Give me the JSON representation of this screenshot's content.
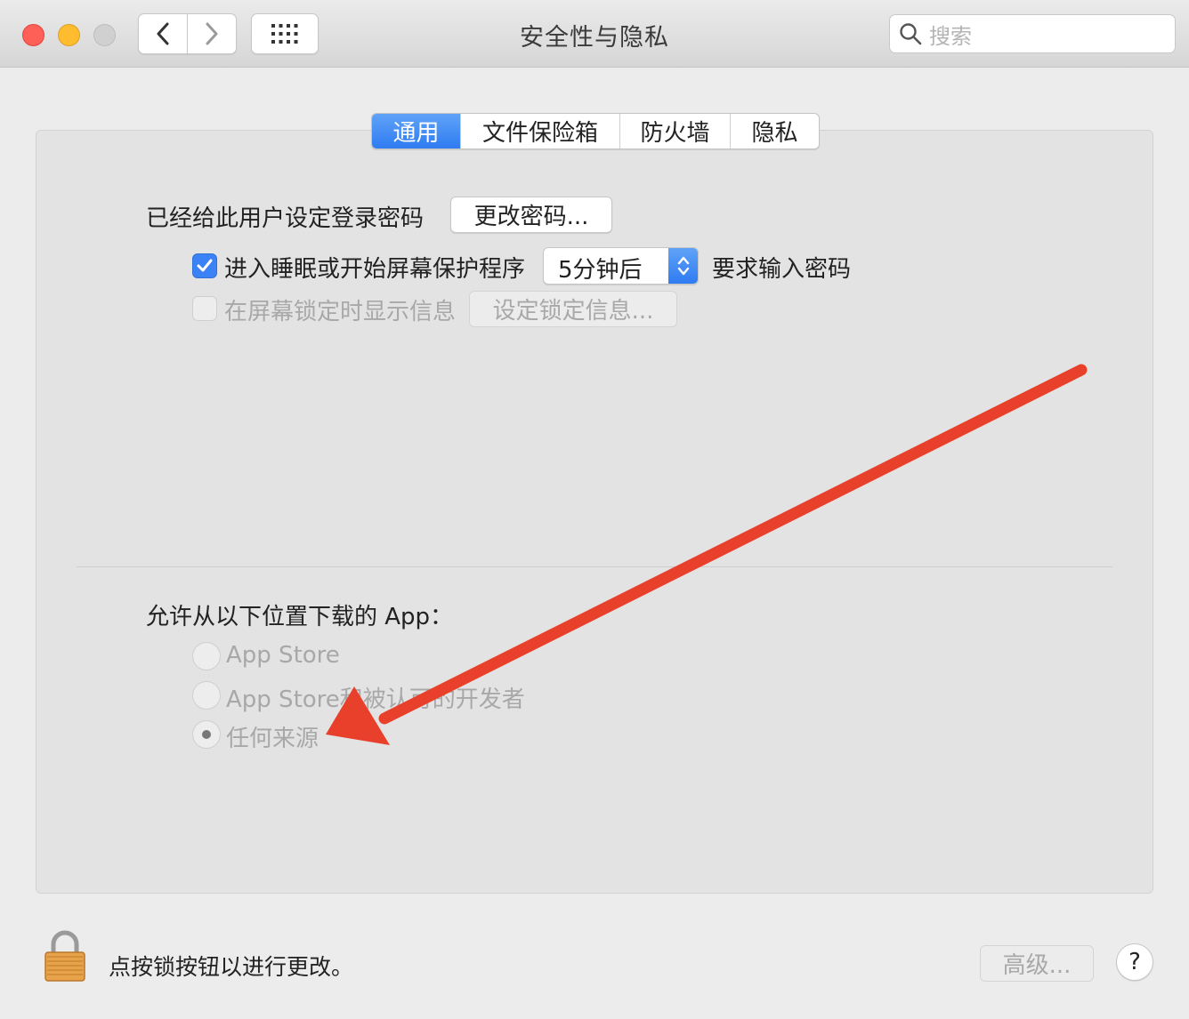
{
  "window": {
    "title": "安全性与隐私",
    "search_placeholder": "搜索"
  },
  "tabs": [
    {
      "label": "通用",
      "active": true
    },
    {
      "label": "文件保险箱",
      "active": false
    },
    {
      "label": "防火墙",
      "active": false
    },
    {
      "label": "隐私",
      "active": false
    }
  ],
  "general": {
    "password_set_label": "已经给此用户设定登录密码",
    "change_password_button": "更改密码...",
    "require_password": {
      "checked": true,
      "label": "进入睡眠或开始屏幕保护程序",
      "delay_value": "5分钟后",
      "suffix": "要求输入密码"
    },
    "lock_message": {
      "checked": false,
      "enabled": false,
      "label": "在屏幕锁定时显示信息",
      "button": "设定锁定信息..."
    }
  },
  "downloads": {
    "heading": "允许从以下位置下载的 App：",
    "options": [
      {
        "label": "App Store",
        "selected": false
      },
      {
        "label": "App Store和被认可的开发者",
        "selected": false
      },
      {
        "label": "任何来源",
        "selected": true
      }
    ]
  },
  "footer": {
    "lock_text": "点按锁按钮以进行更改。",
    "advanced_button": "高级...",
    "help_button": "?"
  },
  "colors": {
    "accent": "#3b82f6",
    "annotation_arrow": "#e8402a"
  },
  "icons": [
    "close-light",
    "minimize-light",
    "zoom-light",
    "chevron-left-icon",
    "chevron-right-icon",
    "grid-icon",
    "search-icon",
    "checkmark-icon",
    "stepper-icon",
    "lock-icon",
    "annotation-arrow"
  ]
}
